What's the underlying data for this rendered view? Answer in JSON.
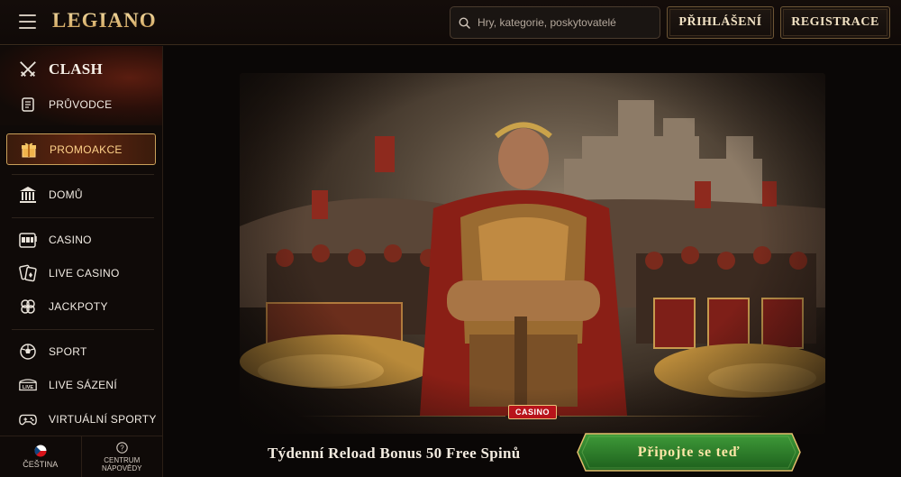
{
  "header": {
    "logo": "LEGIANO",
    "search_placeholder": "Hry, kategorie, poskytovatelé",
    "login_label": "PŘIHLÁŠENÍ",
    "register_label": "REGISTRACE"
  },
  "sidebar": {
    "items": [
      {
        "label": "CLASH",
        "icon": "crossed-swords-icon"
      },
      {
        "label": "PRŮVODCE",
        "icon": "scroll-icon"
      },
      {
        "label": "PROMOAKCE",
        "icon": "gift-icon"
      },
      {
        "label": "DOMŮ",
        "icon": "temple-icon"
      },
      {
        "label": "CASINO",
        "icon": "slot-machine-icon"
      },
      {
        "label": "LIVE CASINO",
        "icon": "playing-cards-icon"
      },
      {
        "label": "JACKPOTY",
        "icon": "clover-icon"
      },
      {
        "label": "SPORT",
        "icon": "ball-icon"
      },
      {
        "label": "LIVE SÁZENÍ",
        "icon": "live-stadium-icon"
      },
      {
        "label": "VIRTUÁLNÍ SPORTY",
        "icon": "gamepad-icon"
      }
    ],
    "language_label": "ČEŠTINA",
    "help_line1": "CENTRUM",
    "help_line2": "NÁPOVĚDY"
  },
  "hero": {
    "badge": "CASINO",
    "text": "Týdenní Reload Bonus 50 Free Spinů",
    "cta_label": "Připojte se teď"
  },
  "colors": {
    "accent_gold": "#e6c489",
    "badge_red": "#b8141b",
    "cta_green": "#2c7a2a",
    "background": "#0b0807"
  }
}
